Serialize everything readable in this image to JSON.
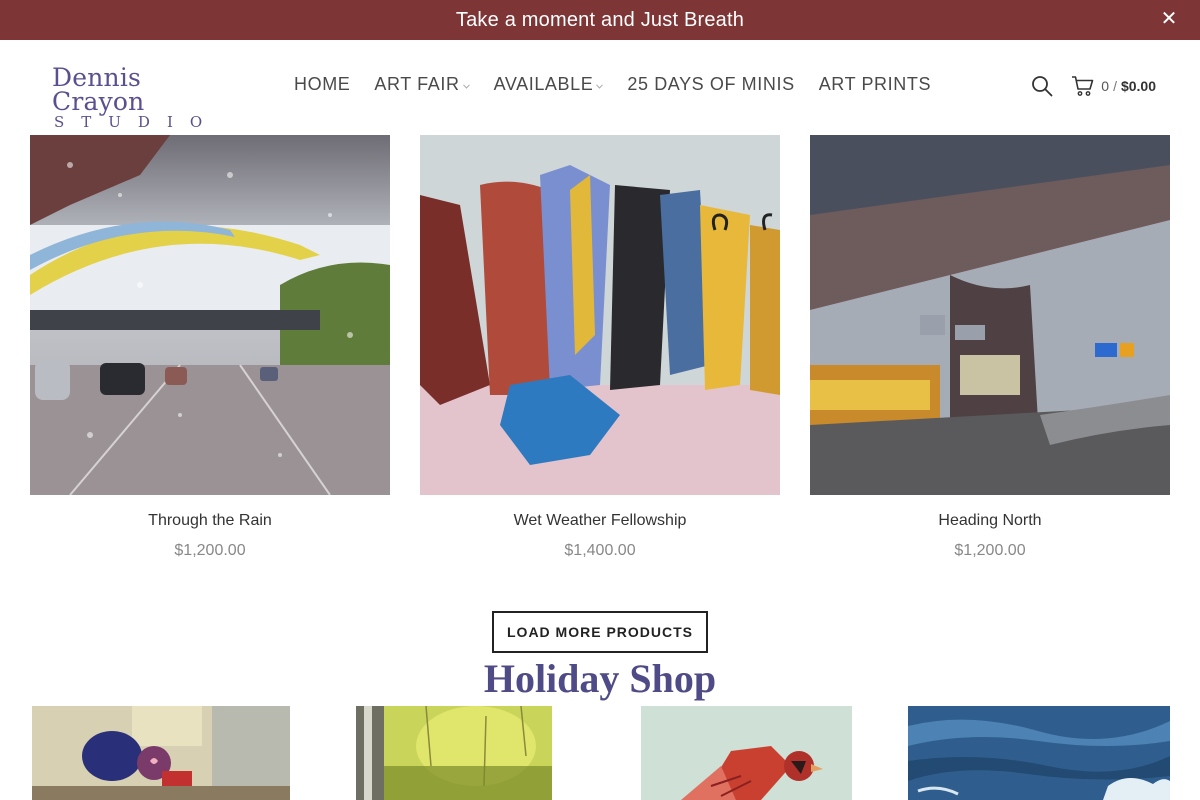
{
  "announcement": {
    "text": "Take a moment and Just Breath",
    "close_symbol": "✕"
  },
  "logo": {
    "line1": "Dennis Crayon",
    "line2": "STUDIO"
  },
  "nav": {
    "items": [
      {
        "label": "HOME",
        "has_dropdown": false
      },
      {
        "label": "ART FAIR",
        "has_dropdown": true
      },
      {
        "label": "AVAILABLE",
        "has_dropdown": true
      },
      {
        "label": "25 DAYS OF MINIS",
        "has_dropdown": false
      },
      {
        "label": "ART PRINTS",
        "has_dropdown": false
      }
    ],
    "caret": "⌄"
  },
  "cart": {
    "count": "0",
    "separator": "/",
    "total": "$0.00"
  },
  "icons": {
    "search": "search-icon",
    "cart": "cart-icon",
    "close": "close-icon"
  },
  "products": [
    {
      "name": "Through the Rain",
      "price": "$1,200.00"
    },
    {
      "name": "Wet Weather Fellowship",
      "price": "$1,400.00"
    },
    {
      "name": "Heading North",
      "price": "$1,200.00"
    }
  ],
  "load_more_label": "LOAD MORE PRODUCTS",
  "holiday_shop": {
    "title": "Holiday Shop"
  },
  "colors": {
    "announcement_bg": "#7d3535",
    "brand_purple": "#5b4f8f",
    "section_title": "#4f4b86"
  }
}
